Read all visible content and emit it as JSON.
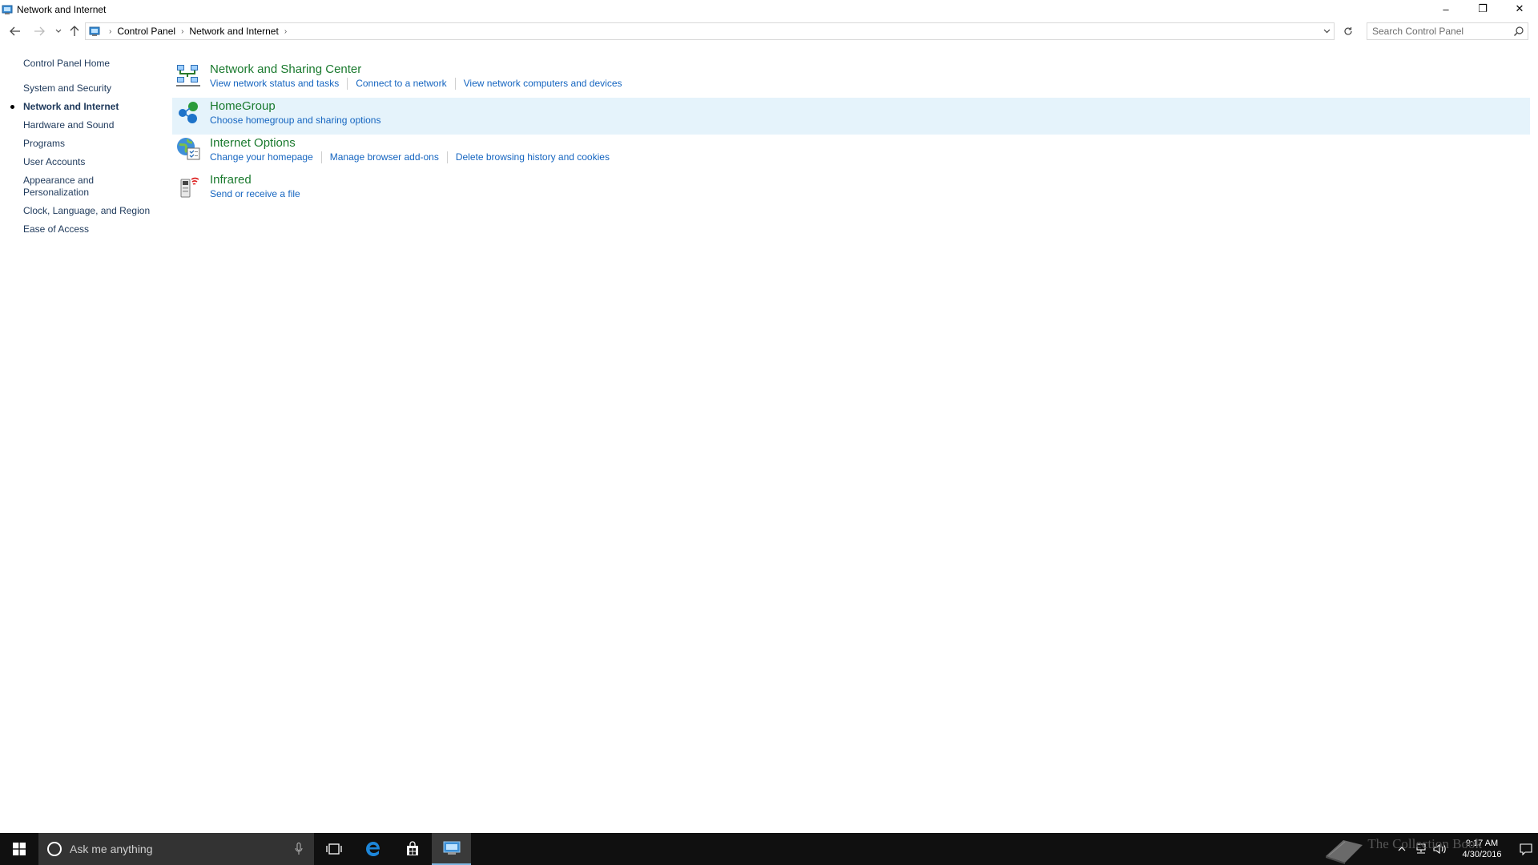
{
  "window": {
    "title": "Network and Internet",
    "controls": {
      "minimize": "–",
      "maximize": "❐",
      "close": "✕"
    }
  },
  "address": {
    "breadcrumbs": [
      "Control Panel",
      "Network and Internet"
    ],
    "search_placeholder": "Search Control Panel"
  },
  "leftnav": {
    "home": "Control Panel Home",
    "items": [
      {
        "label": "System and Security",
        "active": false
      },
      {
        "label": "Network and Internet",
        "active": true
      },
      {
        "label": "Hardware and Sound",
        "active": false
      },
      {
        "label": "Programs",
        "active": false
      },
      {
        "label": "User Accounts",
        "active": false
      },
      {
        "label": "Appearance and Personalization",
        "active": false
      },
      {
        "label": "Clock, Language, and Region",
        "active": false
      },
      {
        "label": "Ease of Access",
        "active": false
      }
    ]
  },
  "categories": [
    {
      "title": "Network and Sharing Center",
      "icon": "network-sharing-icon",
      "links": [
        "View network status and tasks",
        "Connect to a network",
        "View network computers and devices"
      ]
    },
    {
      "title": "HomeGroup",
      "icon": "homegroup-icon",
      "links": [
        "Choose homegroup and sharing options"
      ]
    },
    {
      "title": "Internet Options",
      "icon": "internet-options-icon",
      "links": [
        "Change your homepage",
        "Manage browser add-ons",
        "Delete browsing history and cookies"
      ]
    },
    {
      "title": "Infrared",
      "icon": "infrared-icon",
      "links": [
        "Send or receive a file"
      ]
    }
  ],
  "taskbar": {
    "search_text": "Ask me anything",
    "clock_time": "9:17 AM",
    "clock_date": "4/30/2016",
    "watermark": "The Collection Book"
  },
  "colors": {
    "category_title": "#1a7a2e",
    "link": "#1565c0",
    "nav_text": "#1e395b",
    "hover_bg": "#e5f3fb",
    "taskbar_bg": "#101010"
  }
}
